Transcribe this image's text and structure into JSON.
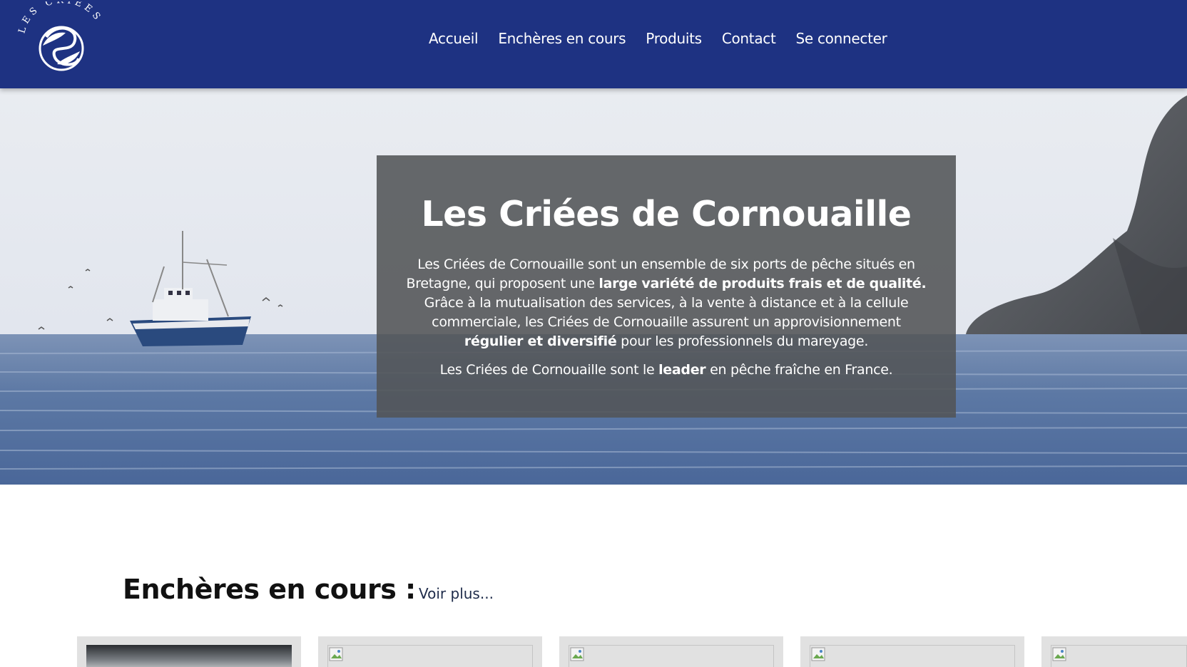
{
  "brand": {
    "logo_text": "LES CRIÉES"
  },
  "nav": {
    "items": [
      "Accueil",
      "Enchères en cours",
      "Produits",
      "Contact",
      "Se connecter"
    ]
  },
  "hero": {
    "title": "Les Criées de Cornouaille",
    "p1_a": "Les Criées de Cornouaille sont un ensemble de six ports de pêche situés en Bretagne, qui proposent une ",
    "p1_b": "large variété de produits frais et de qualité.",
    "p1_c": " Grâce à la mutualisation des services, à la vente à distance et à la cellule commerciale, les Criées de Cornouaille assurent un approvisionnement ",
    "p1_d": "régulier et diversifié",
    "p1_e": " pour les professionnels du mareyage.",
    "p2_a": "Les Criées de Cornouaille sont le ",
    "p2_b": "leader",
    "p2_c": " en pêche fraîche en France."
  },
  "auctions": {
    "title": "Enchères en cours :",
    "see_more": "Voir plus..."
  },
  "colors": {
    "header_bg": "#1e3282",
    "overlay_bg": "#525457",
    "card_bg": "#e1e1e1"
  }
}
